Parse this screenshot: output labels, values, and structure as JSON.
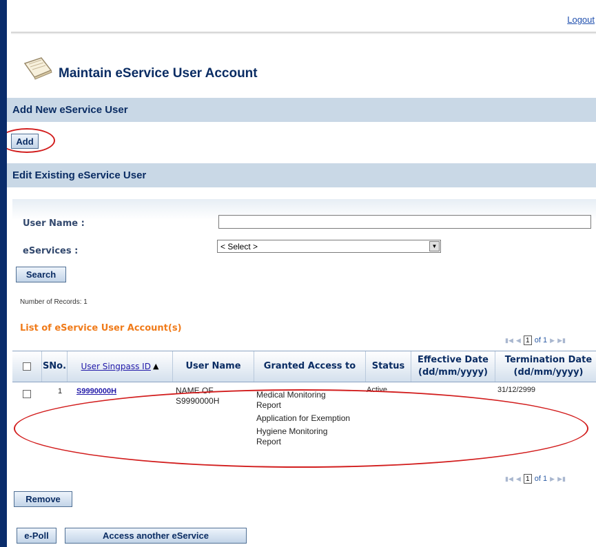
{
  "header": {
    "logout_label": "Logout"
  },
  "page": {
    "title": "Maintain eService User Account"
  },
  "add_section": {
    "title": "Add New eService User",
    "add_button": "Add"
  },
  "edit_section": {
    "title": "Edit Existing eService User"
  },
  "search": {
    "user_name_label": "User Name  :",
    "user_name_value": "",
    "eservices_label": "eServices  :",
    "eservices_selected": "< Select >",
    "search_button": "Search"
  },
  "results": {
    "records_label": "Number of Records: 1",
    "list_title": "List of eService User Account(s)",
    "pager": {
      "page": "1",
      "of_label": "of 1"
    },
    "columns": {
      "sno": "SNo.",
      "singpass_id": "User Singpass ID",
      "user_name": "User Name",
      "granted_access": "Granted Access to",
      "status": "Status",
      "effective_date": "Effective Date (dd/mm/yyyy)",
      "termination_date": "Termination Date (dd/mm/yyyy)"
    },
    "rows": [
      {
        "sno": "1",
        "singpass_id": "S9990000H",
        "user_name": "NAME OF S9990000H",
        "granted_access": [
          "Medical Monitoring Report",
          "Application for Exemption",
          "Hygiene Monitoring Report"
        ],
        "status": "Active",
        "effective_date": "",
        "termination_date": "31/12/2999"
      }
    ]
  },
  "actions": {
    "remove_button": "Remove",
    "epoll_button": "e-Poll",
    "access_another_button": "Access another eService"
  },
  "icons": {
    "page_icon": "notepad-icon",
    "sort_icon": "sort-ascending-icon"
  },
  "colors": {
    "frame": "#0a2c6b",
    "section_bar": "#c9d8e6",
    "heading_text": "#0a2c63",
    "list_title": "#f07b1a",
    "annotation": "#d21d1d"
  }
}
